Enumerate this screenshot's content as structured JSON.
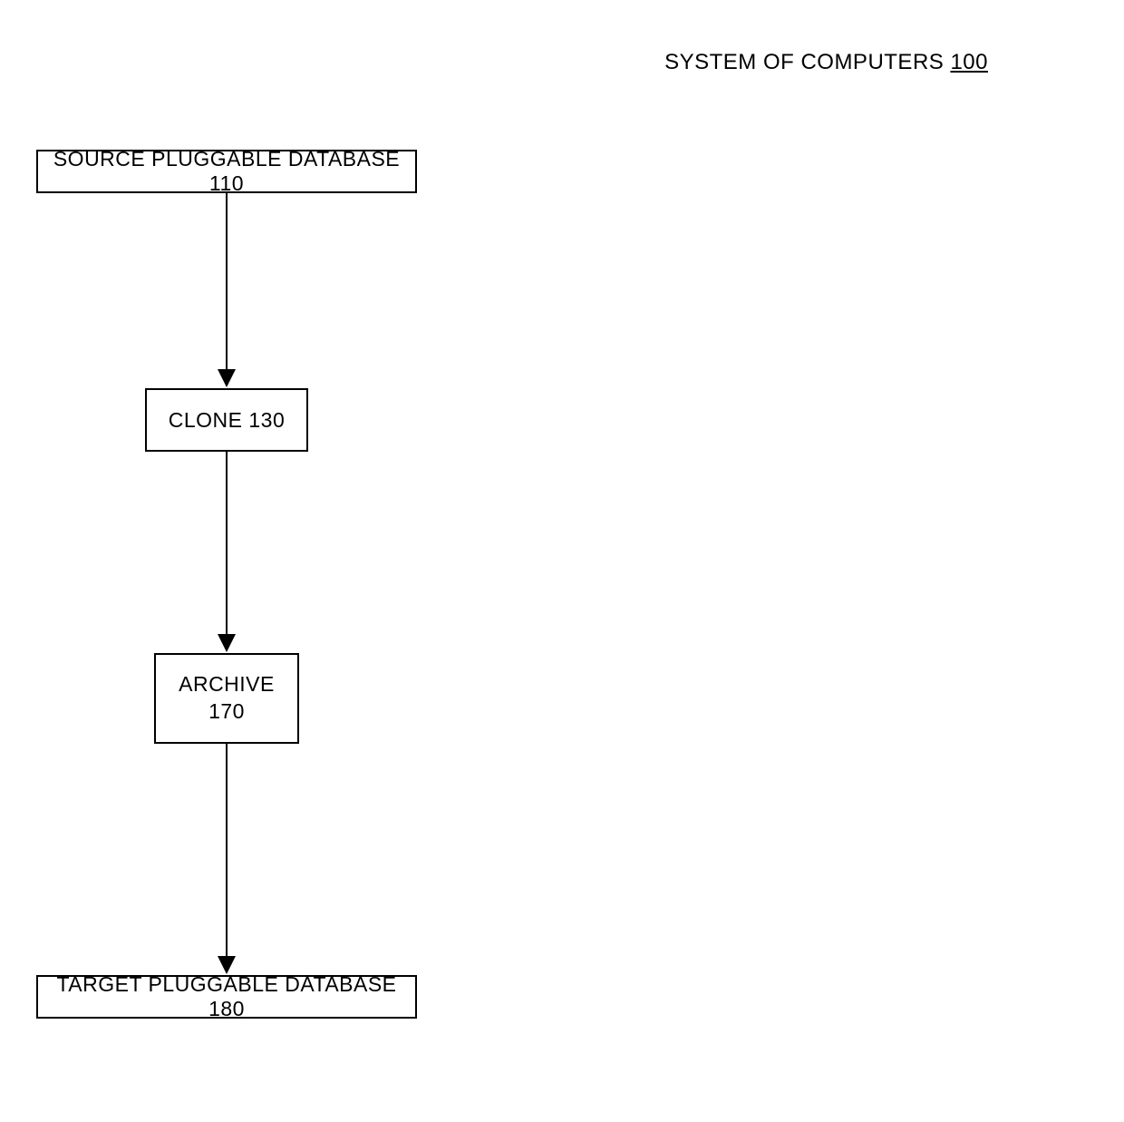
{
  "title": {
    "text": "SYSTEM OF COMPUTERS",
    "number": "100"
  },
  "nodes": {
    "source": "SOURCE PLUGGABLE DATABASE 110",
    "clone": "CLONE 130",
    "archive_label": "ARCHIVE",
    "archive_number": "170",
    "target": "TARGET PLUGGABLE DATABASE 180"
  }
}
